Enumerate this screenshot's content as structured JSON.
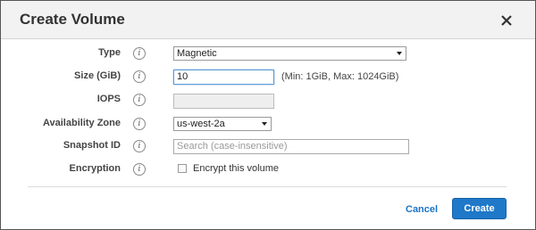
{
  "dialog": {
    "title": "Create Volume"
  },
  "fields": {
    "type": {
      "label": "Type",
      "value": "Magnetic"
    },
    "size": {
      "label": "Size (GiB)",
      "value": "10",
      "hint": "(Min: 1GiB, Max: 1024GiB)"
    },
    "iops": {
      "label": "IOPS",
      "value": ""
    },
    "availability_zone": {
      "label": "Availability Zone",
      "value": "us-west-2a"
    },
    "snapshot_id": {
      "label": "Snapshot ID",
      "placeholder": "Search (case-insensitive)"
    },
    "encryption": {
      "label": "Encryption",
      "checkbox_label": "Encrypt this volume",
      "checked": false
    }
  },
  "info_glyph": "i",
  "icons": {
    "close": "close-icon",
    "info": "info-icon"
  },
  "footer": {
    "cancel_label": "Cancel",
    "create_label": "Create"
  },
  "colors": {
    "accent": "#1f78c8",
    "link": "#1a73c8"
  }
}
